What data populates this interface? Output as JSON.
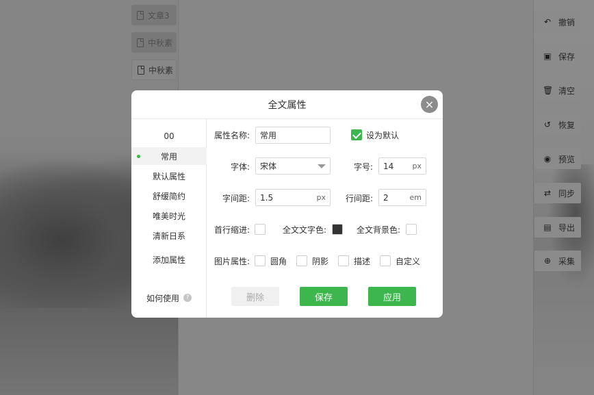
{
  "background": {
    "doc_tabs": [
      {
        "label": "文章3"
      },
      {
        "label": "中秋素"
      },
      {
        "label": "中秋素"
      }
    ],
    "toolbar": [
      {
        "label": "撤销",
        "icon": "undo-icon",
        "glyph": "↶"
      },
      {
        "label": "保存",
        "icon": "save-icon",
        "glyph": "▣"
      },
      {
        "label": "清空",
        "icon": "trash-icon",
        "glyph": "🗑"
      },
      {
        "label": "恢复",
        "icon": "restore-icon",
        "glyph": "↺"
      },
      {
        "label": "预览",
        "icon": "eye-icon",
        "glyph": "◉"
      },
      {
        "label": "同步",
        "icon": "sync-icon",
        "glyph": "⇄"
      },
      {
        "label": "导出",
        "icon": "export-icon",
        "glyph": "▤"
      },
      {
        "label": "采集",
        "icon": "collect-icon",
        "glyph": "⊕"
      }
    ]
  },
  "modal": {
    "title": "全文属性",
    "close_glyph": "×",
    "sidebar": {
      "items": [
        {
          "label": "00"
        },
        {
          "label": "常用",
          "active": true
        },
        {
          "label": "默认属性"
        },
        {
          "label": "舒缓简约"
        },
        {
          "label": "唯美时光"
        },
        {
          "label": "清新日系"
        }
      ],
      "add_label": "添加属性",
      "help_label": "如何使用",
      "help_glyph": "?"
    },
    "form": {
      "name_label": "属性名称:",
      "name_value": "常用",
      "default_label": "设为默认",
      "default_checked": true,
      "font_label": "字体:",
      "font_value": "宋体",
      "size_label": "字号:",
      "size_value": "14",
      "size_unit": "px",
      "letter_spacing_label": "字间距:",
      "letter_spacing_value": "1.5",
      "letter_spacing_unit": "px",
      "line_height_label": "行间距:",
      "line_height_value": "2",
      "line_height_unit": "em",
      "indent_label": "首行缩进:",
      "text_color_label": "全文文字色:",
      "text_color_value": "#333333",
      "bg_color_label": "全文背景色:",
      "bg_color_value": "#ffffff",
      "image_label": "图片属性:",
      "image_options": [
        {
          "label": "圆角"
        },
        {
          "label": "阴影"
        },
        {
          "label": "描述"
        },
        {
          "label": "自定义"
        }
      ]
    },
    "buttons": {
      "delete": "删除",
      "save": "保存",
      "apply": "应用"
    }
  },
  "colors": {
    "accent": "#3db64d",
    "overlay": "rgba(0,0,0,0.42)"
  }
}
